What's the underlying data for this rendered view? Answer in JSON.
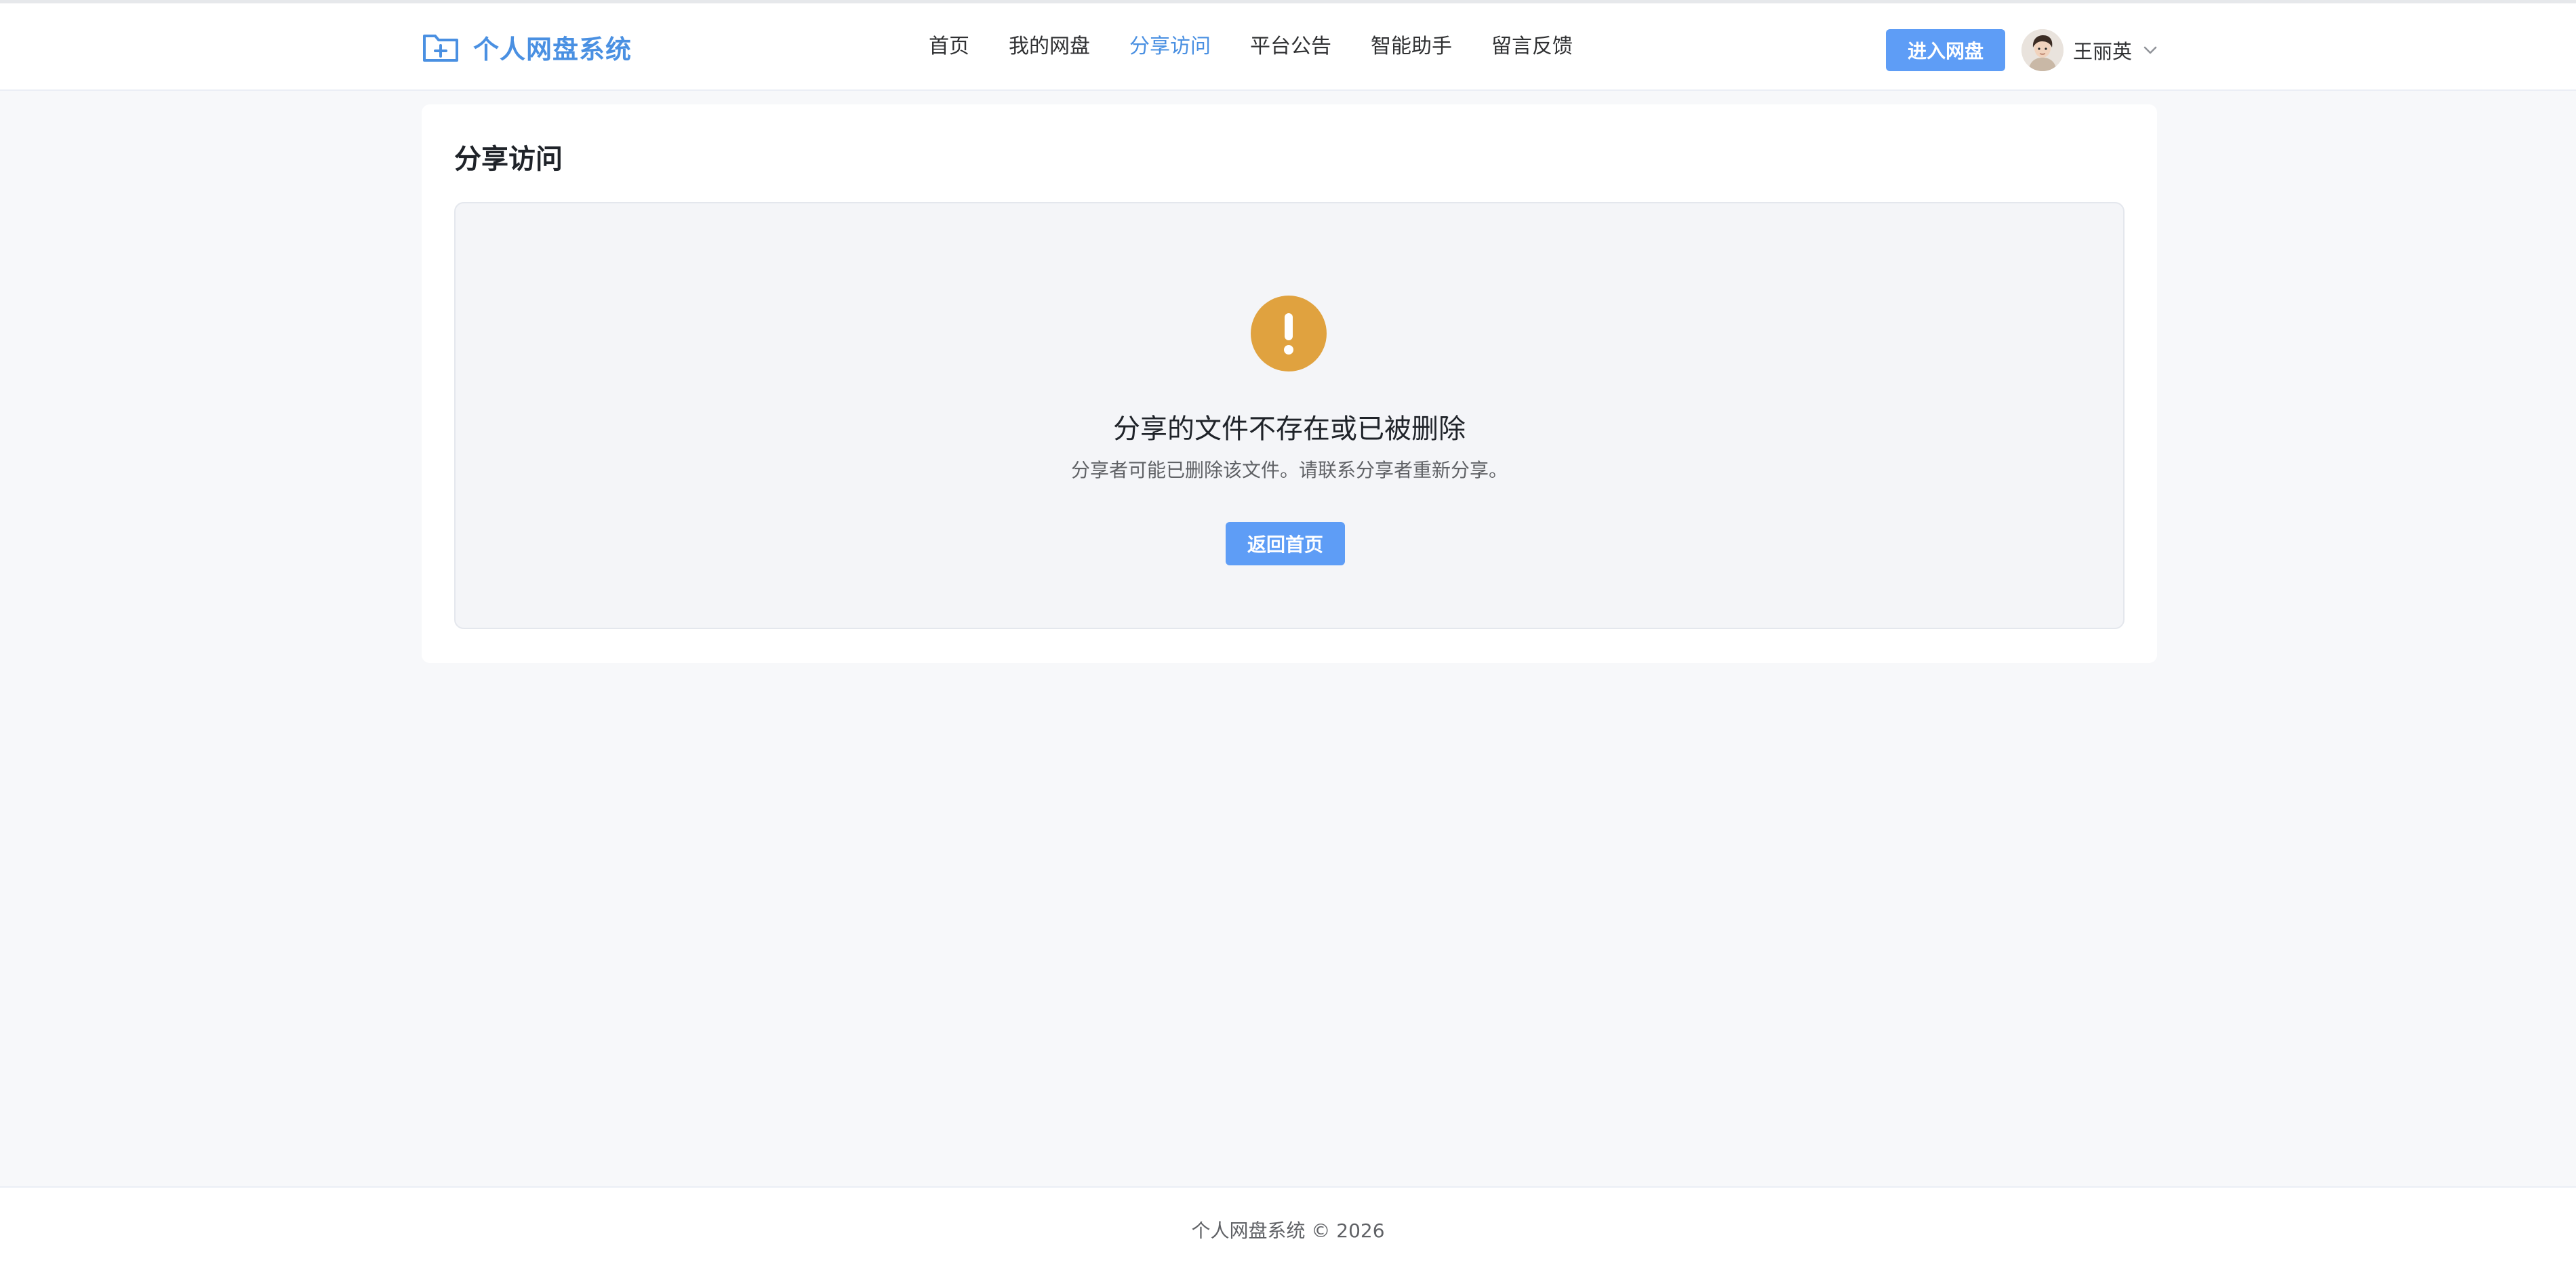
{
  "header": {
    "app_name": "个人网盘系统",
    "logo_icon": "folder-plus-icon",
    "nav": [
      {
        "label": "首页",
        "active": false
      },
      {
        "label": "我的网盘",
        "active": false
      },
      {
        "label": "分享访问",
        "active": true
      },
      {
        "label": "平台公告",
        "active": false
      },
      {
        "label": "智能助手",
        "active": false
      },
      {
        "label": "留言反馈",
        "active": false
      }
    ],
    "enter_button": "进入网盘",
    "user_name": "王丽英",
    "user_menu_icon": "chevron-down-icon"
  },
  "main": {
    "title": "分享访问",
    "status": {
      "icon": "warning-icon",
      "title": "分享的文件不存在或已被删除",
      "description": "分享者可能已删除该文件。请联系分享者重新分享。",
      "back_button": "返回首页"
    }
  },
  "footer": {
    "text": "个人网盘系统 © 2026"
  },
  "colors": {
    "accent": "#4a90e2",
    "button": "#5e9df6",
    "warning": "#e0a23f",
    "page_bg": "#f7f8fa"
  }
}
